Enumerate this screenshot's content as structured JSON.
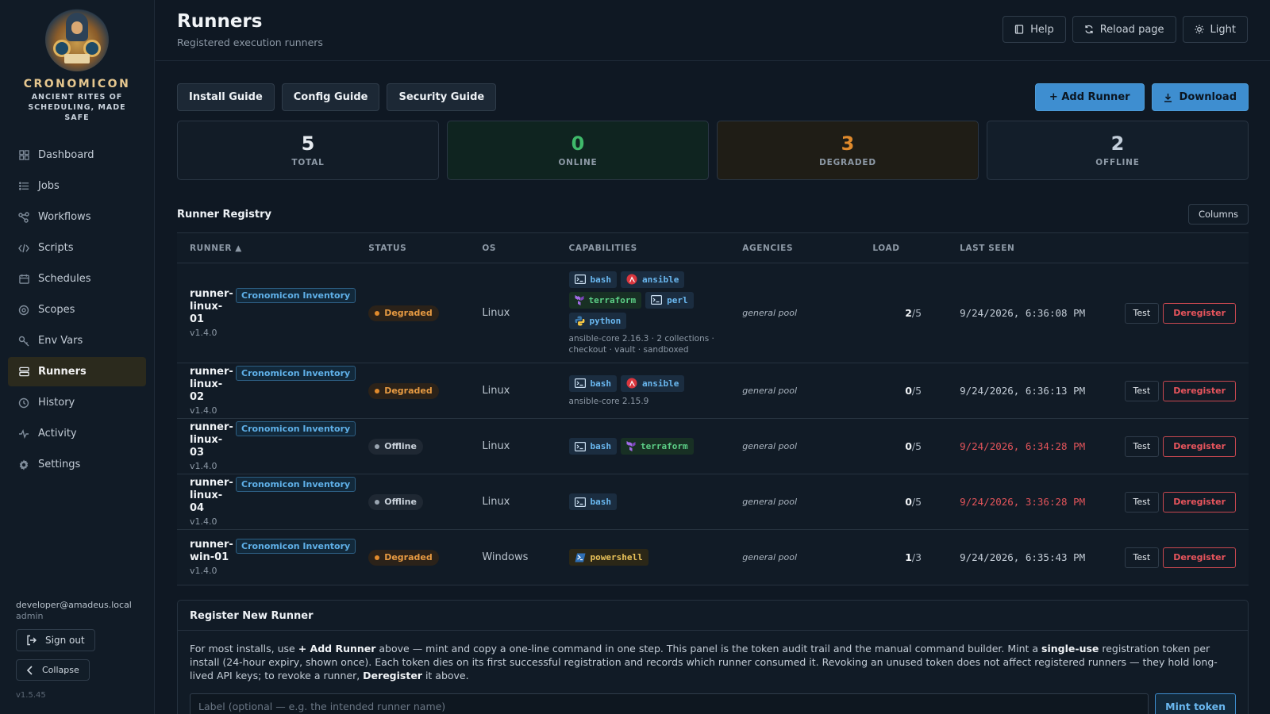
{
  "brand": {
    "name": "CRONOMICON",
    "tagline": "ANCIENT RITES OF SCHEDULING, MADE SAFE"
  },
  "sidebar": {
    "items": [
      {
        "label": "Dashboard",
        "icon": "grid-icon"
      },
      {
        "label": "Jobs",
        "icon": "list-icon"
      },
      {
        "label": "Workflows",
        "icon": "workflow-icon"
      },
      {
        "label": "Scripts",
        "icon": "code-icon"
      },
      {
        "label": "Schedules",
        "icon": "calendar-icon"
      },
      {
        "label": "Scopes",
        "icon": "target-icon"
      },
      {
        "label": "Env Vars",
        "icon": "key-icon"
      },
      {
        "label": "Runners",
        "icon": "server-icon",
        "active": true
      },
      {
        "label": "History",
        "icon": "clock-icon"
      },
      {
        "label": "Activity",
        "icon": "pulse-icon"
      },
      {
        "label": "Settings",
        "icon": "gear-icon"
      }
    ],
    "user_email": "developer@amadeus.local",
    "user_role": "admin",
    "sign_out": "Sign out",
    "collapse": "Collapse",
    "version": "v1.5.45"
  },
  "header": {
    "title": "Runners",
    "subtitle": "Registered execution runners",
    "help": "Help",
    "reload": "Reload page",
    "theme": "Light"
  },
  "toolbar": {
    "install_guide": "Install Guide",
    "config_guide": "Config Guide",
    "security_guide": "Security Guide",
    "add_runner": "+ Add Runner",
    "download": "Download"
  },
  "stats": {
    "total": {
      "value": "5",
      "label": "TOTAL"
    },
    "online": {
      "value": "0",
      "label": "ONLINE"
    },
    "degraded": {
      "value": "3",
      "label": "DEGRADED"
    },
    "offline": {
      "value": "2",
      "label": "OFFLINE"
    }
  },
  "colors": {
    "accent": "#3e8ed0",
    "online": "#3fb96a",
    "degraded": "#e08a2c",
    "danger": "#e2545a"
  },
  "registry": {
    "title": "Runner Registry",
    "columns_button": "Columns",
    "headers": {
      "runner": "RUNNER ▲",
      "status": "STATUS",
      "os": "OS",
      "capabilities": "CAPABILITIES",
      "agencies": "AGENCIES",
      "load": "LOAD",
      "last_seen": "LAST SEEN"
    },
    "test_label": "Test",
    "deregister_label": "Deregister",
    "rows": [
      {
        "name_a": "runner-",
        "name_b": "linux-01",
        "version": "v1.4.0",
        "inventory": "Cronomicon Inventory",
        "status": "Degraded",
        "os": "Linux",
        "caps": [
          "bash",
          "ansible",
          "terraform",
          "perl",
          "python"
        ],
        "cap_note": "ansible-core 2.16.3 · 2 collections · checkout · vault · sandboxed",
        "agency": "general pool",
        "load_used": "2",
        "load_max": "/5",
        "last_seen": "9/24/2026, 6:36:08 PM",
        "stale": false
      },
      {
        "name_a": "runner-",
        "name_b": "linux-02",
        "version": "v1.4.0",
        "inventory": "Cronomicon Inventory",
        "status": "Degraded",
        "os": "Linux",
        "caps": [
          "bash",
          "ansible"
        ],
        "cap_note": "ansible-core 2.15.9",
        "agency": "general pool",
        "load_used": "0",
        "load_max": "/5",
        "last_seen": "9/24/2026, 6:36:13 PM",
        "stale": false
      },
      {
        "name_a": "runner-",
        "name_b": "linux-03",
        "version": "v1.4.0",
        "inventory": "Cronomicon Inventory",
        "status": "Offline",
        "os": "Linux",
        "caps": [
          "bash",
          "terraform"
        ],
        "cap_note": "",
        "agency": "general pool",
        "load_used": "0",
        "load_max": "/5",
        "last_seen": "9/24/2026, 6:34:28 PM",
        "stale": true
      },
      {
        "name_a": "runner-",
        "name_b": "linux-04",
        "version": "v1.4.0",
        "inventory": "Cronomicon Inventory",
        "status": "Offline",
        "os": "Linux",
        "caps": [
          "bash"
        ],
        "cap_note": "",
        "agency": "general pool",
        "load_used": "0",
        "load_max": "/5",
        "last_seen": "9/24/2026, 3:36:28 PM",
        "stale": true
      },
      {
        "name_a": "runner-",
        "name_b": "win-01",
        "version": "v1.4.0",
        "inventory": "Cronomicon Inventory",
        "status": "Degraded",
        "os": "Windows",
        "caps": [
          "powershell"
        ],
        "cap_note": "",
        "agency": "general pool",
        "load_used": "1",
        "load_max": "/3",
        "last_seen": "9/24/2026, 6:35:43 PM",
        "stale": false
      }
    ]
  },
  "register": {
    "title": "Register New Runner",
    "p1": "For most installs, use ",
    "b1": "+ Add Runner",
    "p2": " above — mint and copy a one-line command in one step. This panel is the token audit trail and the manual command builder. Mint a ",
    "b2": "single-use",
    "p3": " registration token per install (24-hour expiry, shown once). Each token dies on its first successful registration and records which runner consumed it. Revoking an unused token does not affect registered runners — they hold long-lived API keys; to revoke a runner, ",
    "b3": "Deregister",
    "p4": " it above.",
    "placeholder": "Label (optional — e.g. the intended runner name)",
    "mint": "Mint token"
  }
}
